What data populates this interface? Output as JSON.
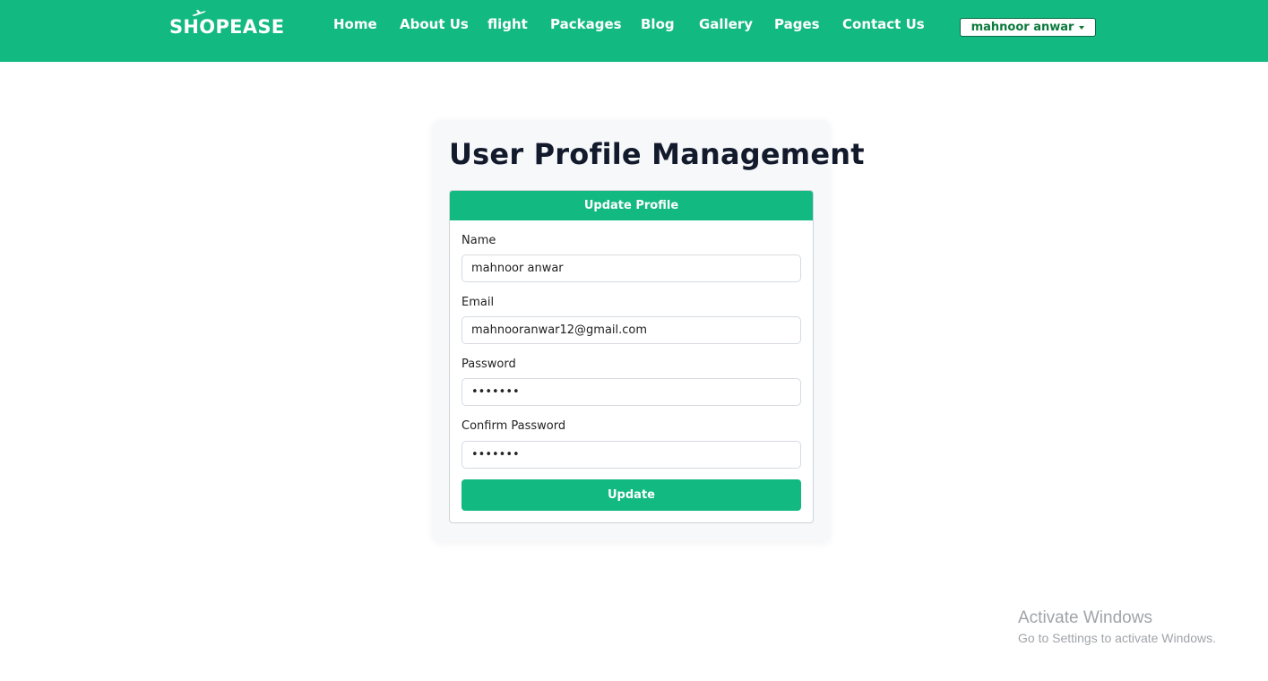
{
  "brand": {
    "name": "SHOPEASE",
    "plane_icon": "airplane-icon"
  },
  "nav": {
    "items": [
      {
        "label": "Home"
      },
      {
        "label": "About Us"
      },
      {
        "label": "flight"
      },
      {
        "label": "Packages"
      },
      {
        "label": "Blog"
      },
      {
        "label": "Gallery"
      },
      {
        "label": "Pages"
      },
      {
        "label": "Contact Us"
      }
    ],
    "user_menu": {
      "label": "mahnoor anwar",
      "icon": "caret-down-icon"
    }
  },
  "main": {
    "title": "User Profile Management",
    "card_header": "Update Profile",
    "fields": {
      "name": {
        "label": "Name",
        "value": "mahnoor anwar"
      },
      "email": {
        "label": "Email",
        "value": "mahnooranwar12@gmail.com"
      },
      "password": {
        "label": "Password",
        "value": "•••••••"
      },
      "confirm_password": {
        "label": "Confirm Password",
        "value": "•••••••"
      }
    },
    "submit_label": "Update"
  },
  "watermark": {
    "title": "Activate Windows",
    "subtitle": "Go to Settings to activate Windows."
  },
  "colors": {
    "brand_green": "#12b981",
    "dropdown_text": "#0b7a3c",
    "title": "#121a2c"
  }
}
